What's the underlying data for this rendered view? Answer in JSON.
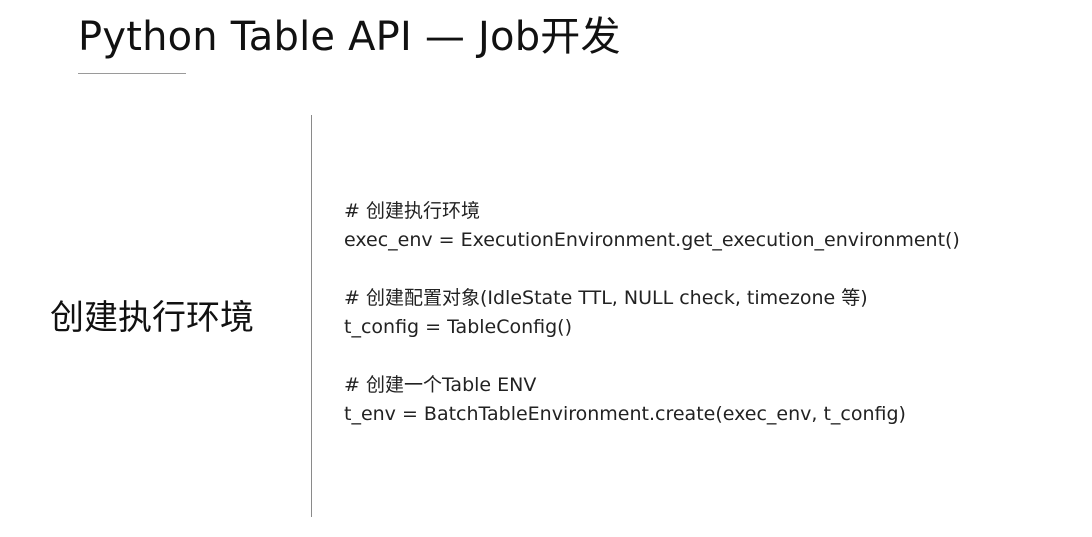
{
  "slide": {
    "title": "Python Table API — Job开发",
    "section_label": "创建执行环境",
    "code_lines": [
      "# 创建执行环境",
      "exec_env = ExecutionEnvironment.get_execution_environment()",
      "",
      "# 创建配置对象(IdleState TTL, NULL check, timezone 等)",
      "t_config = TableConfig()",
      "",
      "# 创建一个Table ENV",
      "t_env = BatchTableEnvironment.create(exec_env, t_config)"
    ]
  }
}
